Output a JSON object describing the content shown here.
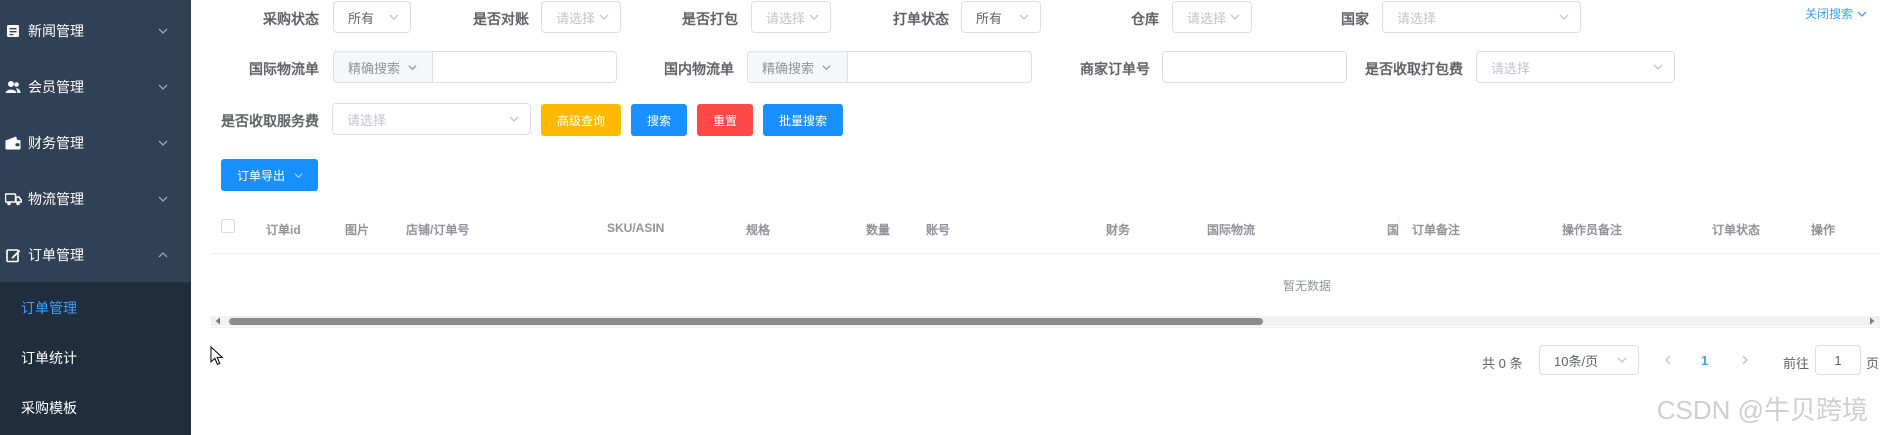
{
  "sidebar": {
    "items": [
      {
        "label": "新闻管理",
        "icon": "document-icon"
      },
      {
        "label": "会员管理",
        "icon": "users-icon"
      },
      {
        "label": "财务管理",
        "icon": "wallet-icon"
      },
      {
        "label": "物流管理",
        "icon": "truck-icon"
      },
      {
        "label": "订单管理",
        "icon": "edit-icon",
        "expanded": true
      }
    ],
    "submenu": [
      {
        "label": "订单管理",
        "active": true
      },
      {
        "label": "订单统计",
        "active": false
      },
      {
        "label": "采购模板",
        "active": false
      }
    ]
  },
  "filters": {
    "purchase_status": {
      "label": "采购状态",
      "value": "所有"
    },
    "reconciled": {
      "label": "是否对账",
      "placeholder": "请选择"
    },
    "packed": {
      "label": "是否打包",
      "placeholder": "请选择"
    },
    "print_status": {
      "label": "打单状态",
      "value": "所有"
    },
    "warehouse": {
      "label": "仓库",
      "placeholder": "请选择"
    },
    "country": {
      "label": "国家",
      "placeholder": "请选择"
    },
    "close_search": "关闭搜索",
    "intl_tracking": {
      "label": "国际物流单",
      "prefix": "精确搜索"
    },
    "domestic_tracking": {
      "label": "国内物流单",
      "prefix": "精确搜索"
    },
    "merchant_order_no": {
      "label": "商家订单号"
    },
    "packing_fee": {
      "label": "是否收取打包费",
      "placeholder": "请选择"
    },
    "service_fee": {
      "label": "是否收取服务费",
      "placeholder": "请选择"
    }
  },
  "buttons": {
    "advanced": "高级查询",
    "search": "搜索",
    "reset": "重置",
    "batch_search": "批量搜索",
    "export": "订单导出"
  },
  "colors": {
    "sidebar_bg": "#304156",
    "submenu_bg": "#1f2d3d",
    "primary": "#1890ff",
    "warning": "#ffba00",
    "danger": "#ff4949"
  },
  "table": {
    "columns": [
      "订单id",
      "图片",
      "店铺/订单号",
      "SKU/ASIN",
      "规格",
      "数量",
      "账号",
      "财务",
      "国际物流",
      "国",
      "订单备注",
      "操作员备注",
      "订单状态",
      "操作"
    ],
    "empty_text": "暂无数据"
  },
  "pagination": {
    "total": "共 0 条",
    "page_size": "10条/页",
    "current_page": "1",
    "goto_label": "前往",
    "goto_value": "1",
    "page_suffix": "页"
  },
  "watermark": "CSDN @牛贝跨境"
}
